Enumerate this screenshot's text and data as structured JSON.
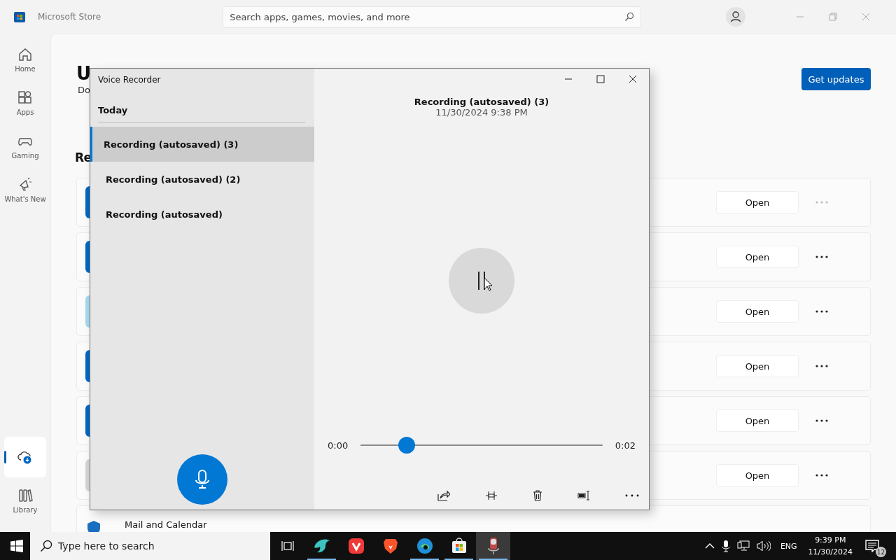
{
  "store": {
    "title": "Microsoft Store",
    "search": {
      "placeholder": "Search apps, games, movies, and more"
    },
    "nav": [
      {
        "label": "Home",
        "selected": false
      },
      {
        "label": "Apps",
        "selected": false
      },
      {
        "label": "Gaming",
        "selected": false
      },
      {
        "label": "What's New",
        "selected": false
      },
      {
        "selected": true
      },
      {
        "label": "Library",
        "selected": false
      }
    ],
    "heading": "U",
    "subheading": "Do",
    "section_heading": "Re",
    "get_updates": "Get updates",
    "rows": [
      {
        "color": "#0067c0",
        "button": "Open",
        "more_disabled": true
      },
      {
        "color": "#0067c0",
        "button": "Open",
        "more_disabled": false
      },
      {
        "color": "#a8d8ee",
        "button": "Open",
        "more_disabled": false
      },
      {
        "color": "#0067c0",
        "button": "Open",
        "more_disabled": false
      },
      {
        "color": "#0067c0",
        "button": "Open",
        "more_disabled": false
      },
      {
        "color": "#d4d4d4",
        "button": "Open",
        "more_disabled": false
      }
    ],
    "partial_row": {
      "name": "Mail and Calendar"
    }
  },
  "recorder": {
    "title": "Voice Recorder",
    "group": "Today",
    "recordings": [
      {
        "name": "Recording (autosaved) (3)",
        "selected": true
      },
      {
        "name": "Recording (autosaved) (2)",
        "selected": false
      },
      {
        "name": "Recording (autosaved)",
        "selected": false
      }
    ],
    "current": {
      "name": "Recording (autosaved) (3)",
      "date": "11/30/2024 9:38 PM"
    },
    "position": "0:00",
    "duration": "0:02",
    "level": 0.19
  },
  "taskbar": {
    "search": {
      "placeholder": "Type here to search"
    },
    "apps": [
      {
        "running": true,
        "selected": false
      },
      {
        "running": false,
        "selected": false
      },
      {
        "running": false,
        "selected": false
      },
      {
        "running": true,
        "selected": false
      },
      {
        "running": true,
        "selected": false
      },
      {
        "running": true,
        "selected": true
      }
    ],
    "language": "ENG",
    "time": "9:39 PM",
    "date": "11/30/2024",
    "notifications": "12"
  }
}
